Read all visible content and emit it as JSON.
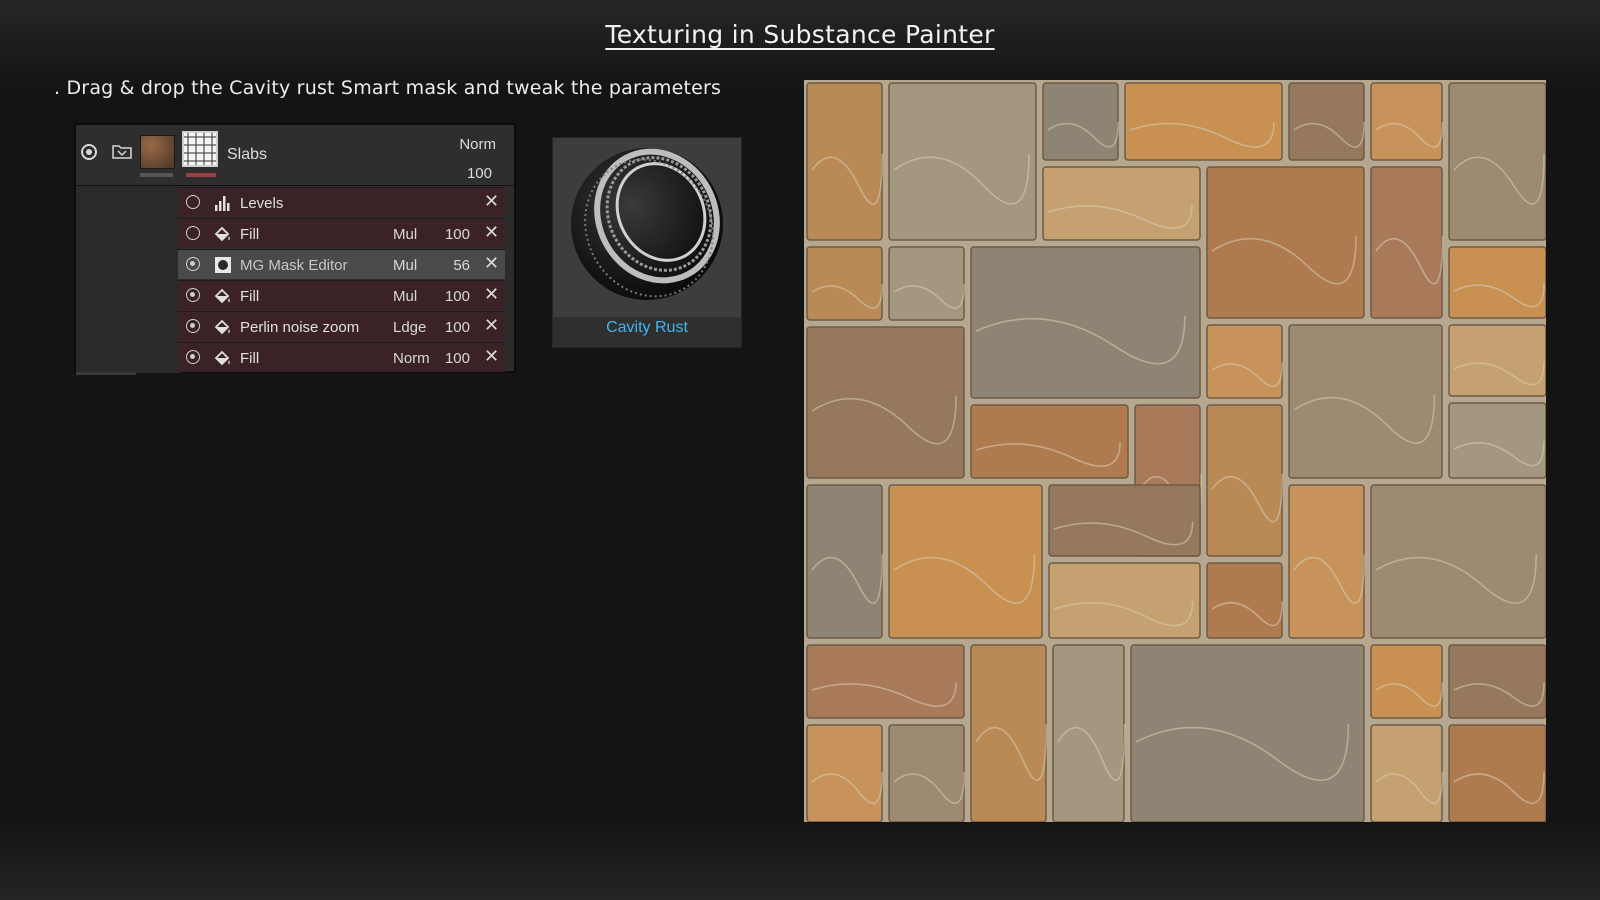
{
  "slide": {
    "title": "Texturing in Substance Painter",
    "instruction": ". Drag & drop the Cavity rust Smart mask and tweak the parameters"
  },
  "layer": {
    "name": "Slabs",
    "blend": "Norm",
    "opacity": "100"
  },
  "effects": [
    {
      "name": "Levels",
      "icon": "levels-icon",
      "blend": "",
      "opacity": "",
      "visible": false,
      "selected": false
    },
    {
      "name": "Fill",
      "icon": "fill-bucket-icon",
      "blend": "Mul",
      "opacity": "100",
      "visible": false,
      "selected": false
    },
    {
      "name": "MG Mask Editor",
      "icon": "generator-icon",
      "blend": "Mul",
      "opacity": "56",
      "visible": true,
      "selected": true
    },
    {
      "name": "Fill",
      "icon": "fill-bucket-icon",
      "blend": "Mul",
      "opacity": "100",
      "visible": true,
      "selected": false
    },
    {
      "name": "Perlin noise zoom",
      "icon": "fill-bucket-icon",
      "blend": "Ldge",
      "opacity": "100",
      "visible": true,
      "selected": false
    },
    {
      "name": "Fill",
      "icon": "fill-bucket-icon",
      "blend": "Norm",
      "opacity": "100",
      "visible": true,
      "selected": false
    }
  ],
  "smart_mask": {
    "label": "Cavity Rust",
    "label_color": "#3fb6f2"
  },
  "colors": {
    "effect_row": "#3b2226",
    "effect_row_selected": "#4a4a4a",
    "accent": "#3fb6f2"
  }
}
